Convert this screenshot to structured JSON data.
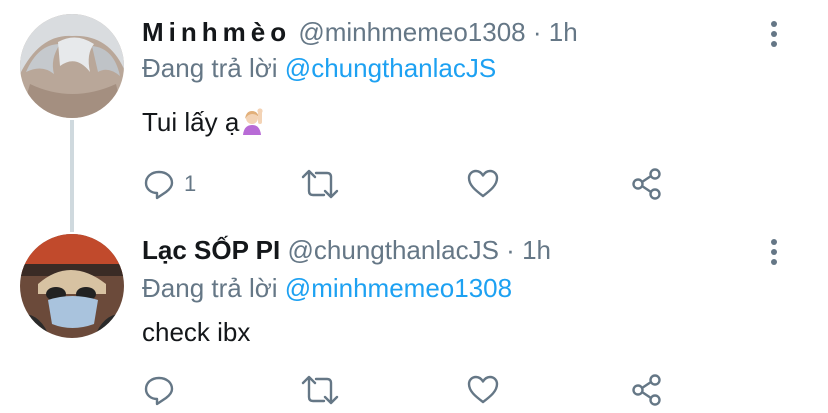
{
  "tweets": [
    {
      "name": "Minhmèo",
      "handle": "@minhmemeo1308",
      "separator": "·",
      "time": "1h",
      "reply_prefix": "Đang trả lời",
      "reply_to": "@chungthanlacJS",
      "text": "Tui lấy ạ",
      "emoji": "person-raising-hand",
      "reply_count": "1",
      "avatar": "gray-haired-avatar"
    },
    {
      "name": "Lạc SỐP PI",
      "handle": "@chungthanlacJS",
      "separator": "·",
      "time": "1h",
      "reply_prefix": "Đang trả lời",
      "reply_to": "@minhmemeo1308",
      "text": "check ibx",
      "reply_count": "",
      "avatar": "masked-person-avatar"
    }
  ],
  "colors": {
    "accent": "#1da1f2",
    "muted": "#657786",
    "text": "#14171a",
    "thread_line": "#cfd9de"
  },
  "icons": [
    "reply-icon",
    "retweet-icon",
    "like-icon",
    "share-icon",
    "more-icon"
  ]
}
